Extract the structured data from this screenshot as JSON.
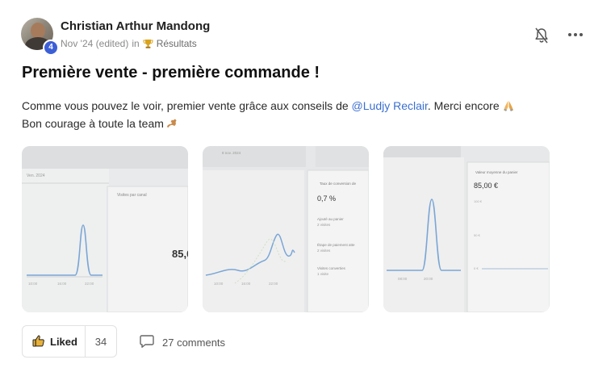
{
  "post": {
    "author": "Christian Arthur Mandong",
    "level": "4",
    "date": "Nov '24 (edited)",
    "in_word": "in",
    "category": "Résultats",
    "title": "Première vente - première commande !",
    "body_part1": "Comme vous pouvez le voir, premier vente grâce aux conseils de ",
    "mention": "@Ludjy Reclair",
    "body_part2": ". Merci encore",
    "body_line2": "Bon courage à toute la team"
  },
  "images": [
    {
      "date_label": "Ven. 2024",
      "panel_label": "Visites par canal",
      "value": "85,0",
      "ticks": [
        "10:00",
        "16:00",
        "22:00"
      ]
    },
    {
      "date_label": "8 nov. 2024",
      "panel_label": "Taux de conversion de",
      "conv_value": "0,7 %",
      "step1": "Ajouté au panier",
      "step1_sub": "2 visites",
      "step2": "Étape de paiement atte",
      "step2_sub": "2 visites",
      "step3": "Visites converties",
      "step3_sub": "1 visite",
      "ticks": [
        "10:00",
        "16:00",
        "22:00"
      ]
    },
    {
      "panel_label": "Valeur moyenne du panier",
      "value": "85,00 €",
      "yticks": [
        "100 €",
        "50 €",
        "0 €"
      ],
      "ticks": [
        "08:00",
        "20:00"
      ]
    }
  ],
  "footer": {
    "like_label": "Liked",
    "like_count": "34",
    "comments_label": "27 comments"
  }
}
